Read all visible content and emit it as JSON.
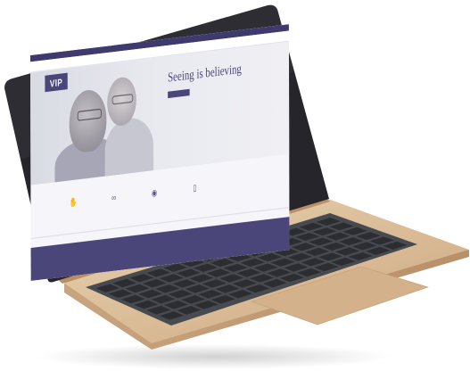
{
  "scene": {
    "description_kind": "photo-mockup",
    "laptop_color": "#d9bc99",
    "keyboard_color": "#474a4f",
    "bezel_color": "#2a2a30"
  },
  "site": {
    "brand": "VIP",
    "accent": "#4b467a",
    "top_links": [
      "",
      "",
      "",
      ""
    ],
    "nav_items": [
      "",
      "",
      "",
      "",
      ""
    ],
    "hero": {
      "headline": "Seeing is believing",
      "subline": "",
      "primary_button": "",
      "secondary_link": ""
    },
    "features": [
      {
        "icon": "hand-icon",
        "title": "",
        "desc": "",
        "link": ""
      },
      {
        "icon": "glasses-icon",
        "title": "",
        "desc": "",
        "link": ""
      },
      {
        "icon": "eye-icon",
        "title": "",
        "desc": "",
        "link": ""
      },
      {
        "icon": "bottle-icon",
        "title": "",
        "desc": "",
        "link": ""
      }
    ],
    "footer_items": [
      "",
      "",
      "",
      "",
      "",
      ""
    ]
  }
}
